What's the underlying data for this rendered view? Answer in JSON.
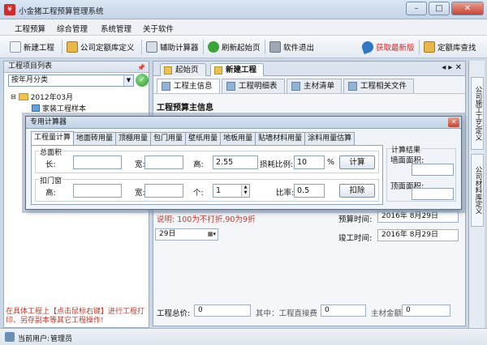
{
  "window": {
    "title": "小金猪工程预算管理系统"
  },
  "menu": {
    "items": [
      "工程预算",
      "综合管理",
      "系统管理",
      "关于软件"
    ]
  },
  "toolbar": {
    "new_project": "新建工程",
    "company_quota": "公司定额库定义",
    "calculator": "辅助计算器",
    "refresh_home": "刷新起始页",
    "exit": "软件退出",
    "get_latest": "获取最新版",
    "quota_lookup": "定额库查找"
  },
  "left_panel": {
    "title": "工程项目列表",
    "grouping": "按年月分类",
    "tree": {
      "month": "2012年03月",
      "sample": "家装工程样本"
    },
    "note": "在具体工程上【点击鼠标右键】进行工程打印、另存副本等其它工程操作!"
  },
  "doc_tabs": [
    "起始页",
    "新建工程"
  ],
  "sub_tabs": [
    "工程主信息",
    "工程明细表",
    "主材清单",
    "工程相关文件"
  ],
  "main": {
    "section_title": "工程预算主信息",
    "discount_note": "说明: 100为不打折,90为9折",
    "date_short": "29日",
    "budget_time_label": "预算时间:",
    "budget_time": "2016年 8月29日",
    "completion_label": "竣工时间:",
    "completion_time": "2016年 8月29日",
    "total_label": "工程总价:",
    "total_value": "0",
    "direct_cost_label": "其中：工程直接费",
    "direct_cost_value": "0",
    "material_label": "主材金额",
    "material_value": "0"
  },
  "right_vtabs": [
    "公司施工工艺定义",
    "公司材料库定义"
  ],
  "status": {
    "label": "当前用户:",
    "user": "管理员"
  },
  "dialog": {
    "title": "专用计算器",
    "tabs": [
      "工程量计算",
      "地面砖用量",
      "顶棚用量",
      "包门用量",
      "壁纸用量",
      "地板用量",
      "贴墙材料用量",
      "涂料用量估算"
    ],
    "total_area": {
      "title": "总面积",
      "length_label": "长:",
      "width_label": "宽:",
      "height_label": "高:",
      "height_value": "2.55",
      "loss_label": "损耗比例:",
      "loss_value": "10",
      "percent": "%",
      "calc_button": "计算"
    },
    "deduct": {
      "title": "扣门窗",
      "height_label": "高:",
      "width_label": "宽:",
      "count_label": "个:",
      "count_value": "1",
      "ratio_label": "比率:",
      "ratio_value": "0.5",
      "deduct_button": "扣除"
    },
    "result": {
      "title": "计算结果",
      "wall_label": "墙面面积:",
      "ceiling_label": "顶面面积:"
    }
  }
}
